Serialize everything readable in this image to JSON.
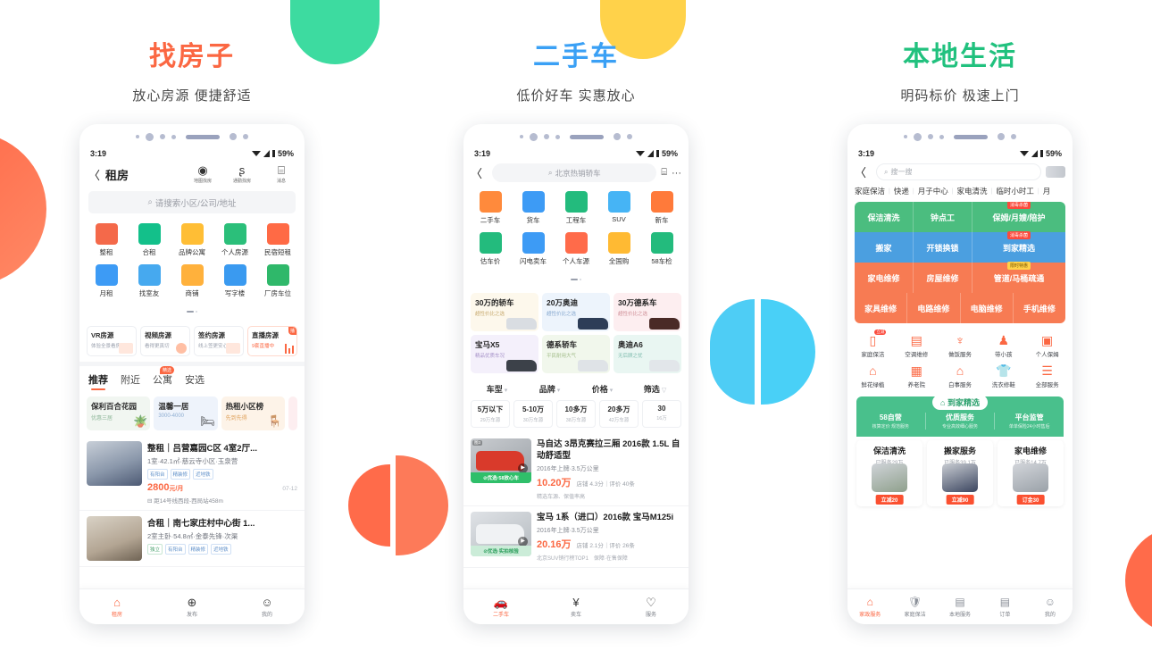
{
  "columns": [
    {
      "title": "找房子",
      "subtitle": "放心房源 便捷舒适",
      "status": {
        "time": "3:19",
        "battery": "59%"
      },
      "nav": {
        "back": "〈",
        "title": "租房",
        "icons": [
          {
            "name": "map-find-house-icon",
            "glyph": "◉",
            "label": "地图找房"
          },
          {
            "name": "commute-find-house-icon",
            "glyph": "ʂ",
            "label": "通勤找房"
          },
          {
            "name": "message-icon",
            "glyph": "⌸",
            "label": "消息"
          }
        ]
      },
      "search": {
        "icon": "search-icon",
        "placeholder": "请搜索小区/公司/地址"
      },
      "categories": [
        {
          "label": "整租",
          "color": "#f4694a"
        },
        {
          "label": "合租",
          "color": "#13c08a"
        },
        {
          "label": "品牌公寓",
          "color": "#ffbe35"
        },
        {
          "label": "个人房源",
          "color": "#2bbf7a"
        },
        {
          "label": "民宿短租",
          "color": "#ff6a45"
        },
        {
          "label": "月租",
          "color": "#3d9bf5"
        },
        {
          "label": "找室友",
          "color": "#46a9ef"
        },
        {
          "label": "商铺",
          "color": "#ffb13c"
        },
        {
          "label": "写字楼",
          "color": "#3a9af0"
        },
        {
          "label": "厂房车位",
          "color": "#2fb86a"
        }
      ],
      "promos": [
        {
          "title": "VR房源",
          "sub": "体验全景看房",
          "badge": ""
        },
        {
          "title": "视频房源",
          "sub": "看得更真切",
          "badge": ""
        },
        {
          "title": "签约房源",
          "sub": "线上签更安心",
          "badge": ""
        },
        {
          "title": "直播房源",
          "sub": "9套直播中",
          "badge": "播"
        }
      ],
      "tabs": [
        {
          "label": "推荐",
          "active": true,
          "badge": ""
        },
        {
          "label": "附近",
          "active": false,
          "badge": ""
        },
        {
          "label": "公寓",
          "active": false,
          "badge": "精选"
        },
        {
          "label": "安选",
          "active": false,
          "badge": ""
        }
      ],
      "chips": [
        {
          "title": "保利百合花园",
          "sub": "优惠三居",
          "icon": "🪴"
        },
        {
          "title": "温馨一居",
          "sub": "3000-4000",
          "icon": "🛏"
        },
        {
          "title": "热租小区榜",
          "sub": "先到先得",
          "icon": "🪑"
        }
      ],
      "listings": [
        {
          "title": "整租｜吕营嘉园C区 4室2厅...",
          "meta": "1室·42.1㎡·慈云寺小区·玉泉营",
          "tags": [
            "有阳台",
            "精装修",
            "近地铁"
          ],
          "price": "2800",
          "price_unit": "元/月",
          "date": "07-12",
          "sub": "⊟ 距14号线西段-西局站458m"
        },
        {
          "title": "合租｜南七家庄村中心街 1...",
          "meta": "2室主卧·54.8㎡·金泰先锋·次渠",
          "tags": [
            "独立",
            "有阳台",
            "精装修",
            "近地铁"
          ],
          "price": "",
          "price_unit": "",
          "date": "",
          "sub": ""
        }
      ],
      "bottom_nav": [
        {
          "label": "租房",
          "glyph": "⌂",
          "active": true
        },
        {
          "label": "发布",
          "glyph": "⊕",
          "active": false
        },
        {
          "label": "我的",
          "glyph": "☺",
          "active": false
        }
      ]
    },
    {
      "title": "二手车",
      "subtitle": "低价好车 实惠放心",
      "status": {
        "time": "3:19",
        "battery": "59%"
      },
      "nav": {
        "back": "〈",
        "search_placeholder": "北京热销轿车",
        "message_icon": "⌸",
        "more_icon": "···"
      },
      "categories": [
        {
          "label": "二手车",
          "color": "#ff8a3c"
        },
        {
          "label": "货车",
          "color": "#3d9bf5"
        },
        {
          "label": "工程车",
          "color": "#23bb7d"
        },
        {
          "label": "SUV",
          "color": "#46b4f5"
        },
        {
          "label": "新车",
          "color": "#ff7a3a"
        },
        {
          "label": "估车价",
          "color": "#23bb7d"
        },
        {
          "label": "闪电卖车",
          "color": "#3d9bf5"
        },
        {
          "label": "个人车源",
          "color": "#ff6b4a"
        },
        {
          "label": "全国购",
          "color": "#ffba33"
        },
        {
          "label": "58车检",
          "color": "#23bb7d"
        }
      ],
      "cards": [
        {
          "title": "30万的轿车",
          "sub": "超性价比之选"
        },
        {
          "title": "20万奥迪",
          "sub": "超性价比之选"
        },
        {
          "title": "30万德系车",
          "sub": "超性价比之选"
        },
        {
          "title": "宝马X5",
          "sub": "精品优质车况"
        },
        {
          "title": "德系轿车",
          "sub": "平民耐用大气"
        },
        {
          "title": "奥迪A6",
          "sub": "无后顾之忧"
        }
      ],
      "filters": [
        {
          "label": "车型",
          "arrow": "▾"
        },
        {
          "label": "品牌",
          "arrow": "▾"
        },
        {
          "label": "价格",
          "arrow": "▾"
        },
        {
          "label": "筛选",
          "arrow": "▽"
        }
      ],
      "price_chips": [
        {
          "title": "5万以下",
          "sub": "29万车源"
        },
        {
          "title": "5-10万",
          "sub": "30万车源"
        },
        {
          "title": "10多万",
          "sub": "38万车源"
        },
        {
          "title": "20多万",
          "sub": "42万车源"
        },
        {
          "title": "30",
          "sub": "16万"
        }
      ],
      "listings": [
        {
          "title": "马自达 3昂克赛拉三厢 2016款 1.5L 自动舒适型",
          "meta": "2016年上牌·3.5万公里",
          "price": "10.20万",
          "shop": "店铺 4.3分｜评价 40条",
          "tags": [
            "精选车源、保值率高"
          ],
          "badge": "⊘优选·58放心车",
          "thumb_label": "图3"
        },
        {
          "title": "宝马 1系（进口）2016款 宝马M125i",
          "meta": "2016年上牌·3.5万公里",
          "price": "20.16万",
          "shop": "店铺 2.1分｜评价 26条",
          "tags": [
            "北京SUV销行榜TOP1",
            "保障·在售保障"
          ],
          "badge": "⊘优选·实拍核验",
          "thumb_label": ""
        }
      ],
      "bottom_nav": [
        {
          "label": "二手车",
          "glyph": "🚗",
          "active": true
        },
        {
          "label": "卖车",
          "glyph": "¥",
          "active": false
        },
        {
          "label": "服务",
          "glyph": "♡",
          "active": false
        }
      ]
    },
    {
      "title": "本地生活",
      "subtitle": "明码标价 极速上门",
      "status": {
        "time": "3:19",
        "battery": "59%"
      },
      "nav": {
        "back": "〈",
        "search_placeholder": "搜一搜"
      },
      "cats": [
        "家庭保洁",
        "快递",
        "月子中心",
        "家电清洗",
        "临时小时工",
        "月"
      ],
      "service_grid": [
        {
          "cells": [
            {
              "label": "保洁清洗",
              "badge": ""
            },
            {
              "label": "钟点工",
              "badge": ""
            },
            {
              "label": "保姆/月嫂/陪护",
              "badge": "消毒杀菌"
            }
          ]
        },
        {
          "cells": [
            {
              "label": "搬家",
              "badge": ""
            },
            {
              "label": "开锁换锁",
              "badge": ""
            },
            {
              "label": "到家精选",
              "badge": "消毒杀菌"
            }
          ]
        },
        {
          "cells": [
            {
              "label": "家电维修",
              "badge": ""
            },
            {
              "label": "房屋维修",
              "badge": ""
            },
            {
              "label": "管道/马桶疏通",
              "badge": "限时特惠"
            }
          ]
        },
        {
          "cells": [
            {
              "label": "家具维修",
              "badge": ""
            },
            {
              "label": "电路维修",
              "badge": ""
            },
            {
              "label": "电脑维修",
              "badge": ""
            },
            {
              "label": "手机维修",
              "badge": ""
            }
          ]
        }
      ],
      "icons": [
        {
          "label": "家庭保洁",
          "glyph": "▯",
          "tag": "立减"
        },
        {
          "label": "空调维修",
          "glyph": "▤",
          "tag": ""
        },
        {
          "label": "做饭服务",
          "glyph": "♆",
          "tag": ""
        },
        {
          "label": "带小孩",
          "glyph": "♟",
          "tag": ""
        },
        {
          "label": "个人保姆",
          "glyph": "▣",
          "tag": ""
        },
        {
          "label": "鲜花绿植",
          "glyph": "⌂",
          "tag": ""
        },
        {
          "label": "养老院",
          "glyph": "▦",
          "tag": ""
        },
        {
          "label": "白事服务",
          "glyph": "⌂",
          "tag": ""
        },
        {
          "label": "洗衣修鞋",
          "glyph": "👕",
          "tag": ""
        },
        {
          "label": "全部服务",
          "glyph": "☰",
          "tag": ""
        }
      ],
      "banner": {
        "pill_icon": "⌂",
        "pill": "到家精选",
        "columns": [
          {
            "title": "58自营",
            "sub": "核算定价 规范服务"
          },
          {
            "title": "优质服务",
            "sub": "专业高效细心服务"
          },
          {
            "title": "平台监管",
            "sub": "单单保险24小时售后"
          }
        ]
      },
      "service_cards": [
        {
          "title": "保洁清洗",
          "sub": "已服务29万",
          "pill": "立减20"
        },
        {
          "title": "搬家服务",
          "sub": "已服务39.1万",
          "pill": "立减90"
        },
        {
          "title": "家电维修",
          "sub": "已服务14.7万",
          "pill": "订金30"
        }
      ],
      "bottom_nav": [
        {
          "label": "家政服务",
          "glyph": "⌂",
          "active": true
        },
        {
          "label": "家庭保洁",
          "glyph": "🛡",
          "active": false
        },
        {
          "label": "本地服务",
          "glyph": "▤",
          "active": false
        },
        {
          "label": "订单",
          "glyph": "▤",
          "active": false
        },
        {
          "label": "我的",
          "glyph": "☺",
          "active": false
        }
      ]
    }
  ],
  "colors": {
    "orange": "#fb6742",
    "blue": "#3aa0f5",
    "green": "#21c17e",
    "yellow": "#ffd24a",
    "cyan": "#49d0f7"
  }
}
